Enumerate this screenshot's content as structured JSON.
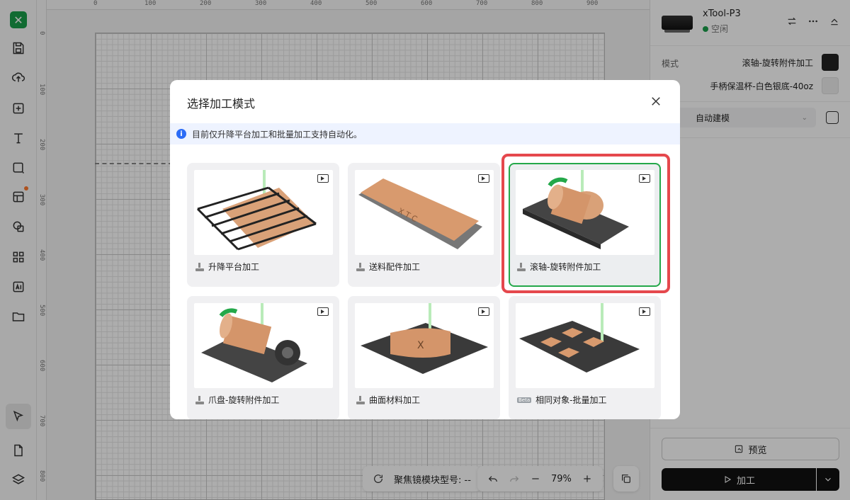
{
  "ruler": {
    "top": [
      "0",
      "100",
      "200",
      "300",
      "400",
      "500",
      "600",
      "700",
      "800",
      "900"
    ],
    "left": [
      "0",
      "100",
      "200",
      "300",
      "400",
      "500",
      "600",
      "700",
      "800"
    ]
  },
  "device": {
    "name": "xTool-P3",
    "status": "空闲"
  },
  "panel": {
    "mode_label": "模式",
    "mode_value": "滚轴-旋转附件加工",
    "material_value": "手柄保温杯-白色银底-40oz",
    "auto_model": "自动建模"
  },
  "canvas_controls": {
    "lens_label": "聚焦镜模块型号: --",
    "zoom": "79%"
  },
  "actions": {
    "preview": "预览",
    "run": "加工"
  },
  "modal": {
    "title": "选择加工模式",
    "info": "目前仅升降平台加工和批量加工支持自动化。",
    "cards": [
      {
        "label": "升降平台加工",
        "icon": "lift-mode-icon",
        "selected": false
      },
      {
        "label": "送料配件加工",
        "icon": "feeder-mode-icon",
        "selected": false
      },
      {
        "label": "滚轴-旋转附件加工",
        "icon": "roller-mode-icon",
        "selected": true
      },
      {
        "label": "爪盘-旋转附件加工",
        "icon": "chuck-mode-icon",
        "selected": false
      },
      {
        "label": "曲面材料加工",
        "icon": "curved-mode-icon",
        "selected": false
      },
      {
        "label": "相同对象-批量加工",
        "icon": "beta-badge-icon",
        "badge": "Beta",
        "selected": false
      }
    ]
  },
  "colors": {
    "accent": "#1a9e4b",
    "selected_border": "#24a84a",
    "highlight": "#e5484d",
    "info_bg": "#eef3ff"
  }
}
